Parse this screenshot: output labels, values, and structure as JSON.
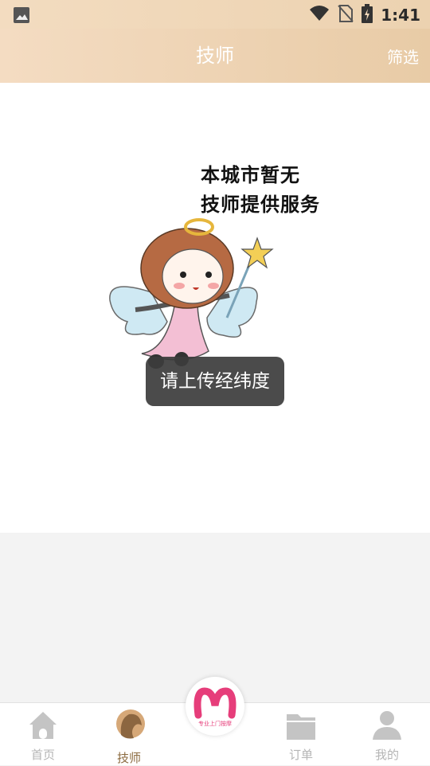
{
  "status_bar": {
    "time": "1:41",
    "icons": [
      "image-icon",
      "wifi-icon",
      "no-sim-icon",
      "battery-charging-icon"
    ]
  },
  "header": {
    "title": "技师",
    "filter_label": "筛选"
  },
  "empty_state": {
    "line1": "本城市暂无",
    "line2": "技师提供服务",
    "illustration": "angel-girl-illustration"
  },
  "toast": {
    "message": "请上传经纬度"
  },
  "tabbar": {
    "items": [
      {
        "label": "首页",
        "icon": "home-icon",
        "active": false
      },
      {
        "label": "技师",
        "icon": "technician-icon",
        "active": true
      },
      {
        "label": "订单",
        "icon": "folder-icon",
        "active": false
      },
      {
        "label": "我的",
        "icon": "user-icon",
        "active": false
      }
    ],
    "center_logo_text": "专业上门按摩"
  },
  "colors": {
    "header_start": "#f4dcc2",
    "header_end": "#e8cba6",
    "active_tab": "#8b6a3f",
    "inactive_tab": "#b5b5b5",
    "logo_pink": "#e63d7a"
  }
}
